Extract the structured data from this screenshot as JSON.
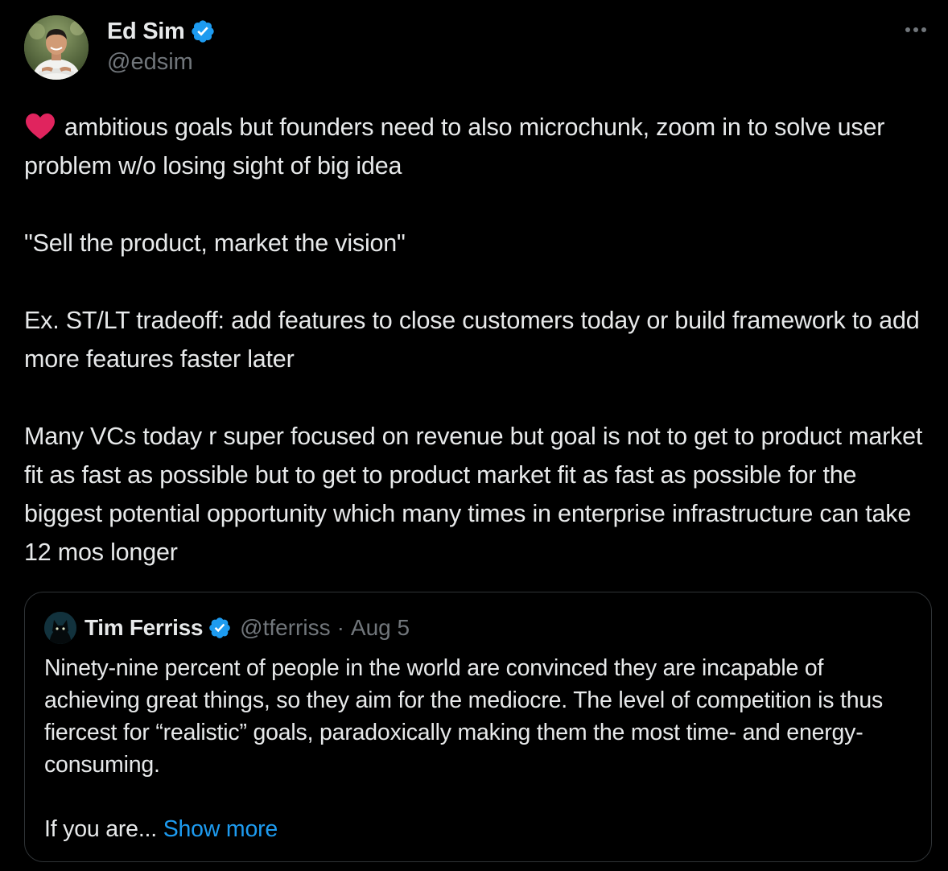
{
  "author": {
    "name": "Ed Sim",
    "handle": "@edsim",
    "verified": true,
    "avatar_icon": "person-photo"
  },
  "menu": {
    "icon": "more-horizontal-icon"
  },
  "tweet": {
    "emoji": "red-heart",
    "paragraphs": [
      "ambitious goals but founders need to also microchunk, zoom in to solve user problem w/o losing sight of big idea",
      "\"Sell the product, market the vision\"",
      "Ex. ST/LT tradeoff: add features to close customers today or build framework to add more features faster later",
      "Many VCs today r super focused on revenue but goal is not to get to product market fit as fast as possible but to get to product market fit as fast as possible for the biggest potential opportunity which many times in enterprise infrastructure can take 12 mos longer"
    ]
  },
  "quote": {
    "name": "Tim Ferriss",
    "handle": "@tferriss",
    "separator": "·",
    "date": "Aug 5",
    "verified": true,
    "paragraphs": [
      "Ninety-nine percent of people in the world are convinced they are incapable of achieving great things, so they aim for the mediocre. The level of competition is thus fiercest for “realistic” goals, paradoxically making them the most time- and energy-consuming."
    ],
    "truncated_text": "If you are...",
    "show_more_label": "Show more"
  },
  "colors": {
    "background": "#000000",
    "text": "#e7e9ea",
    "muted": "#71767b",
    "link": "#1d9bf0",
    "border": "#2f3336",
    "verified": "#1d9bf0",
    "heart": "#e0245e"
  }
}
